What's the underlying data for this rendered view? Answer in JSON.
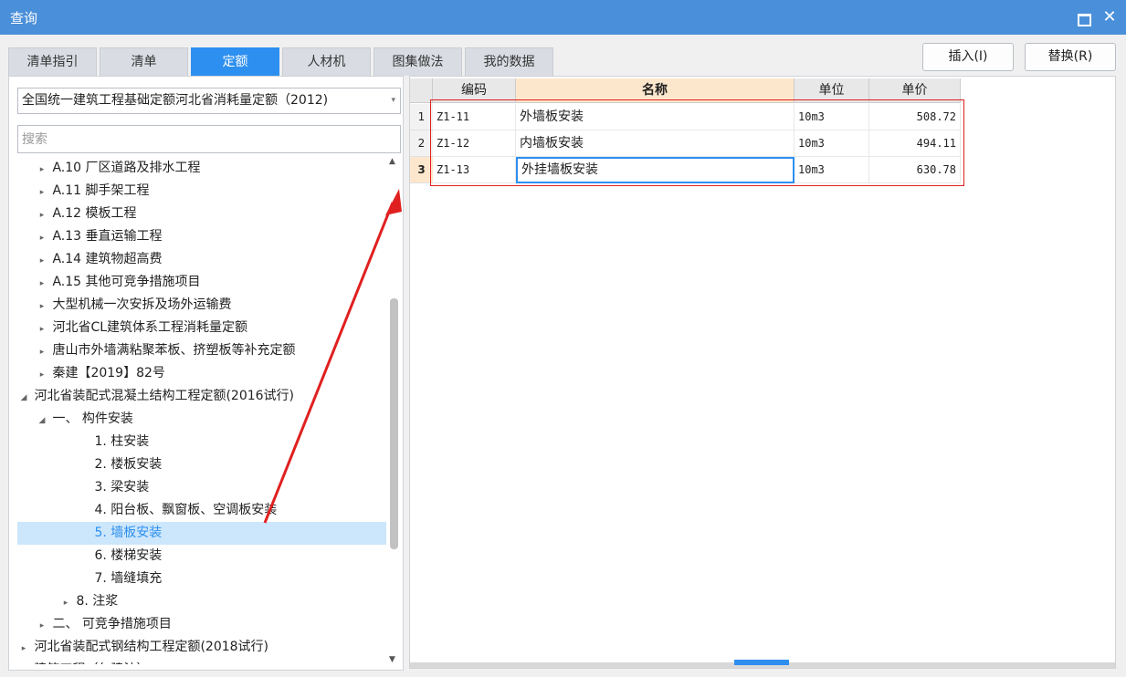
{
  "window": {
    "title": "查询"
  },
  "tabs": [
    "清单指引",
    "清单",
    "定额",
    "人材机",
    "图集做法",
    "我的数据"
  ],
  "active_tab": "定额",
  "buttons": {
    "insert": "插入(I)",
    "replace": "替换(R)"
  },
  "library_select": "全国统一建筑工程基础定额河北省消耗量定额（2012)",
  "search": {
    "placeholder": "搜索",
    "value": ""
  },
  "tree": [
    {
      "label": "A.10 厂区道路及排水工程",
      "level": 1,
      "toggle": "▸"
    },
    {
      "label": "A.11 脚手架工程",
      "level": 1,
      "toggle": "▸"
    },
    {
      "label": "A.12 模板工程",
      "level": 1,
      "toggle": "▸"
    },
    {
      "label": "A.13 垂直运输工程",
      "level": 1,
      "toggle": "▸"
    },
    {
      "label": "A.14 建筑物超高费",
      "level": 1,
      "toggle": "▸"
    },
    {
      "label": "A.15 其他可竞争措施项目",
      "level": 1,
      "toggle": "▸"
    },
    {
      "label": "大型机械一次安拆及场外运输费",
      "level": 1,
      "toggle": "▸"
    },
    {
      "label": "河北省CL建筑体系工程消耗量定额",
      "level": 1,
      "toggle": "▸"
    },
    {
      "label": "唐山市外墙满粘聚苯板、挤塑板等补充定额",
      "level": 1,
      "toggle": "▸"
    },
    {
      "label": "秦建【2019】82号",
      "level": 1,
      "toggle": "▸"
    },
    {
      "label": "河北省装配式混凝土结构工程定额(2016试行)",
      "level": 0,
      "toggle": "◢"
    },
    {
      "label": "一、 构件安装",
      "level": 1,
      "toggle": "◢"
    },
    {
      "label": "1. 柱安装",
      "level": 3,
      "toggle": ""
    },
    {
      "label": "2. 楼板安装",
      "level": 3,
      "toggle": ""
    },
    {
      "label": "3. 梁安装",
      "level": 3,
      "toggle": ""
    },
    {
      "label": "4. 阳台板、飘窗板、空调板安装",
      "level": 3,
      "toggle": ""
    },
    {
      "label": "5. 墙板安装",
      "level": 3,
      "toggle": "",
      "selected": true
    },
    {
      "label": "6. 楼梯安装",
      "level": 3,
      "toggle": ""
    },
    {
      "label": "7. 墙缝填充",
      "level": 3,
      "toggle": ""
    },
    {
      "label": "8. 注浆",
      "level": 2,
      "toggle": "▸"
    },
    {
      "label": "二、 可竞争措施项目",
      "level": 1,
      "toggle": "▸"
    },
    {
      "label": "河北省装配式钢结构工程定额(2018试行)",
      "level": 0,
      "toggle": "▸"
    },
    {
      "label": "建筑工程（仁建法）",
      "level": 0,
      "toggle": ""
    }
  ],
  "table": {
    "headers": {
      "code": "编码",
      "name": "名称",
      "unit": "单位",
      "price": "单价"
    },
    "rows": [
      {
        "n": "1",
        "code": "Z1-11",
        "name": "外墙板安装",
        "unit": "10m3",
        "price": "508.72"
      },
      {
        "n": "2",
        "code": "Z1-12",
        "name": "内墙板安装",
        "unit": "10m3",
        "price": "494.11"
      },
      {
        "n": "3",
        "code": "Z1-13",
        "name": "外挂墙板安装",
        "unit": "10m3",
        "price": "630.78"
      }
    ]
  },
  "colors": {
    "titlebar": "#4a8fd9",
    "accent": "#2d8ff0",
    "annotation": "#e02020"
  }
}
